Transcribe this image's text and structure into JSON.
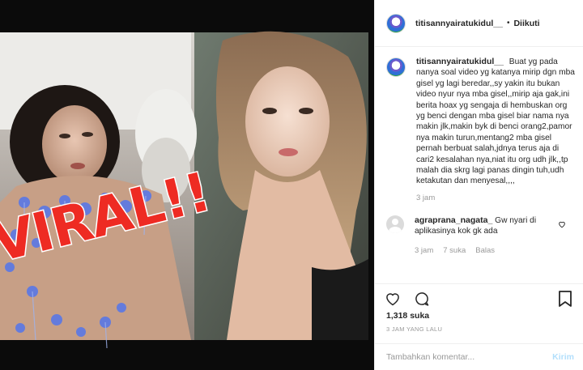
{
  "post": {
    "username": "titisannyairatukidul__",
    "separator": "•",
    "follow_status": "Diikuti",
    "image": {
      "overlay_text": "VIRAL!!",
      "overlay_color": "#ee2b23"
    }
  },
  "caption": {
    "username": "titisannyairatukidul__",
    "text": "Buat yg pada nanya soal video yg katanya mirip dgn mba gisel yg lagi beredar,,sy yakin itu bukan video nyur nya mba gisel,,mirip aja gak,ini berita hoax yg sengaja di hembuskan org yg benci dengan mba gisel biar nama nya makin jlk,makin byk di benci orang2,pamor nya makin turun,mentang2 mba gisel pernah berbuat salah,jdnya terus aja di cari2 kesalahan nya,niat itu org udh jlk,,tp malah dia skrg lagi panas dingin tuh,udh ketakutan dan menyesal,,,,",
    "time": "3 jam"
  },
  "comments": [
    {
      "username": "agraprana_nagata_",
      "text": "Gw nyari di aplikasinya kok gk ada",
      "time": "3 jam",
      "likes": "7 suka",
      "reply_label": "Balas"
    }
  ],
  "actions": {
    "icons": [
      "heart-icon",
      "comment-icon",
      "bookmark-icon"
    ],
    "likes_count": "1,318 suka",
    "date": "3 JAM YANG LALU"
  },
  "comment_box": {
    "placeholder": "Tambahkan komentar...",
    "post_label": "Kirim",
    "post_color": "#b2dffc"
  }
}
